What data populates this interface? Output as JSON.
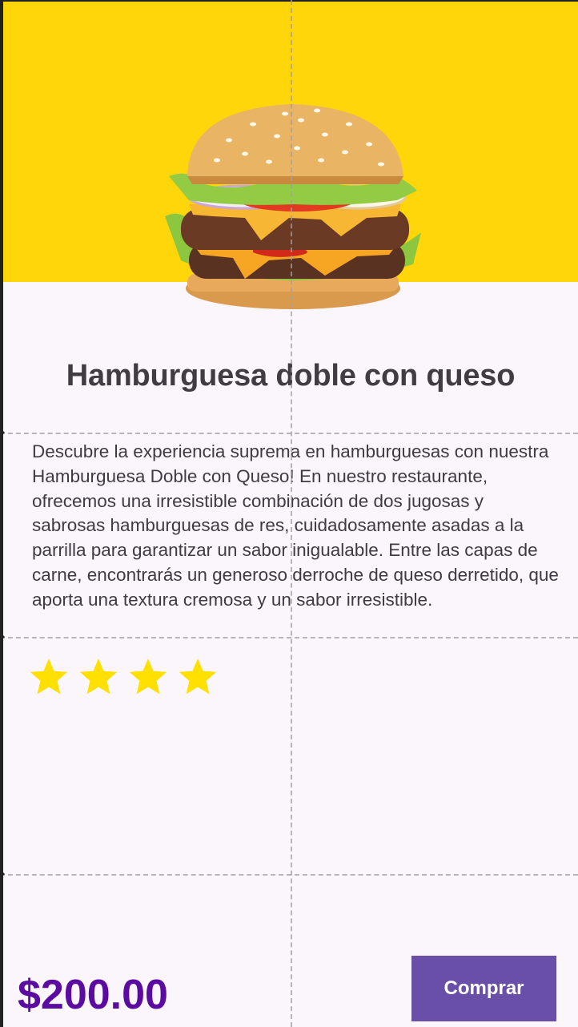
{
  "product": {
    "title": "Hamburguesa doble con queso",
    "description": "Descubre la experiencia suprema en hamburguesas con nuestra Hamburguesa Doble con Queso! En nuestro restaurante, ofrecemos una irresistible combinación de dos jugosas y sabrosas hamburguesas de res, cuidadosamente asadas a la parrilla para garantizar un sabor inigualable. Entre las capas de carne, encontrarás un generoso derroche de queso derretido, que aporta una textura cremosa y un sabor irresistible.",
    "rating": 4,
    "price": "$200.00",
    "buy_label": "Comprar",
    "image_icon": "burger-image"
  },
  "colors": {
    "hero_background": "#ffd60a",
    "star": "#ffe000",
    "price": "#5b0ba0",
    "button": "#6a4fa8"
  }
}
